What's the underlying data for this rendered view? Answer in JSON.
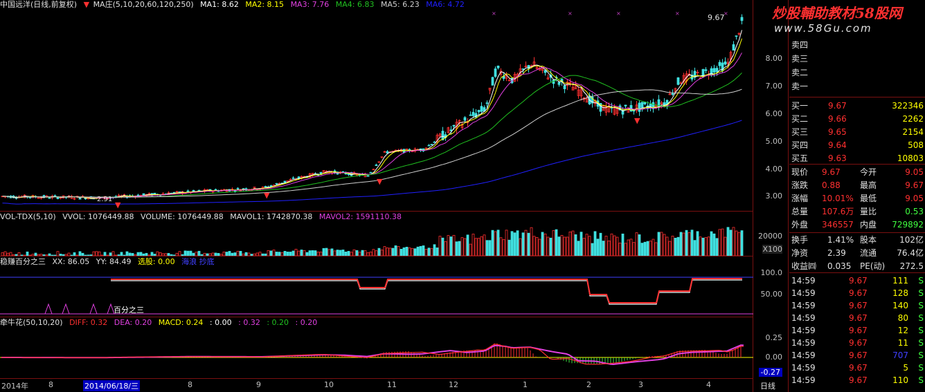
{
  "colors": {
    "up": "#ff3030",
    "down": "#40e0e0",
    "ma1": "#ffffff",
    "ma2": "#ffff00",
    "ma3": "#e040e0",
    "ma4": "#20c020",
    "ma5": "#d0d0d0",
    "ma6": "#2020ff",
    "grid": "#7a1010",
    "text": "#c0c0c0"
  },
  "main": {
    "title": "中国远洋(日线,前复权)",
    "indicator": "MA庄(5,10,20,60,120,250)",
    "ma1": "MA1: 8.62",
    "ma2": "MA2: 8.15",
    "ma3": "MA3: 7.76",
    "ma4": "MA4: 6.83",
    "ma5": "MA5: 6.23",
    "ma6": "MA6: 4.72",
    "high_label": "9.67",
    "low_label": "2.91",
    "yticks": [
      "8.00",
      "7.00",
      "6.00",
      "5.00",
      "4.00",
      "3.00"
    ]
  },
  "vol": {
    "title": "VOL-TDX(5,10)",
    "vvol": "VVOL: 1076449.88",
    "volume": "VOLUME: 1076449.88",
    "mavol1": "MAVOL1: 1742870.38",
    "mavol2": "MAVOL2: 1591110.38",
    "ytick": "20000",
    "unit": "X100"
  },
  "ind2": {
    "title": "稳赚百分之三",
    "xx": "XX: 86.05",
    "yy": "YY: 84.49",
    "xuangu": "选股: 0.00",
    "extra": "海浪  抄底",
    "signal": "百分之三",
    "yticks": [
      "100.0",
      "50.00"
    ]
  },
  "macd": {
    "title": "牵牛花(50,10,20)",
    "diff": "DIFF: 0.32",
    "dea": "DEA: 0.20",
    "macd": "MACD: 0.24",
    "v1": ": 0.00",
    "v2": ": 0.32",
    "v3": ": 0.20",
    "v4": ": 0.20",
    "yticks": [
      "0.25",
      "0.00"
    ],
    "neg": "-0.27"
  },
  "dates": {
    "labels": [
      "2014年",
      "8",
      "2014/06/18/三",
      "8",
      "9",
      "10",
      "11",
      "12",
      "1",
      "2",
      "3",
      "4"
    ],
    "period": "日线"
  },
  "watermark": {
    "line1": "炒股輔助教材58股网",
    "line2": "www.58Gu.com"
  },
  "book": {
    "sells": [
      {
        "label": "卖四"
      },
      {
        "label": "卖三"
      },
      {
        "label": "卖二"
      },
      {
        "label": "卖一"
      }
    ],
    "buys": [
      {
        "label": "买一",
        "price": "9.67",
        "vol": "322346"
      },
      {
        "label": "买二",
        "price": "9.66",
        "vol": "2262"
      },
      {
        "label": "买三",
        "price": "9.65",
        "vol": "2154"
      },
      {
        "label": "买四",
        "price": "9.64",
        "vol": "508"
      },
      {
        "label": "买五",
        "price": "9.63",
        "vol": "10803"
      }
    ],
    "stats": [
      {
        "l1": "现价",
        "v1": "9.67",
        "l2": "今开",
        "v2": "9.05"
      },
      {
        "l1": "涨跌",
        "v1": "0.88",
        "l2": "最高",
        "v2": "9.67"
      },
      {
        "l1": "涨幅",
        "v1": "10.01%",
        "l2": "最低",
        "v2": "9.05"
      },
      {
        "l1": "总量",
        "v1": "107.6万",
        "l2": "量比",
        "v2": "0.53"
      },
      {
        "l1": "外盘",
        "v1": "346557",
        "l2": "内盘",
        "v2": "729892"
      }
    ],
    "stats2": [
      {
        "l1": "换手",
        "v1": "1.41%",
        "l2": "股本",
        "v2": "102亿"
      },
      {
        "l1": "净资",
        "v1": "2.39",
        "l2": "流通",
        "v2": "76.4亿"
      },
      {
        "l1": "收益㈣",
        "v1": "0.035",
        "l2": "PE(动)",
        "v2": "272.5"
      }
    ],
    "ticks": [
      {
        "time": "14:59",
        "price": "9.67",
        "vol": "111",
        "side": "S"
      },
      {
        "time": "14:59",
        "price": "9.67",
        "vol": "128",
        "side": "S"
      },
      {
        "time": "14:59",
        "price": "9.67",
        "vol": "140",
        "side": "S"
      },
      {
        "time": "14:59",
        "price": "9.67",
        "vol": "80",
        "side": "S"
      },
      {
        "time": "14:59",
        "price": "9.67",
        "vol": "12",
        "side": "S"
      },
      {
        "time": "14:59",
        "price": "9.67",
        "vol": "11",
        "side": "S"
      },
      {
        "time": "14:59",
        "price": "9.67",
        "vol": "707",
        "side": "S"
      },
      {
        "time": "14:59",
        "price": "9.67",
        "vol": "5",
        "side": "S"
      },
      {
        "time": "14:59",
        "price": "9.67",
        "vol": "110",
        "side": "S"
      }
    ]
  }
}
